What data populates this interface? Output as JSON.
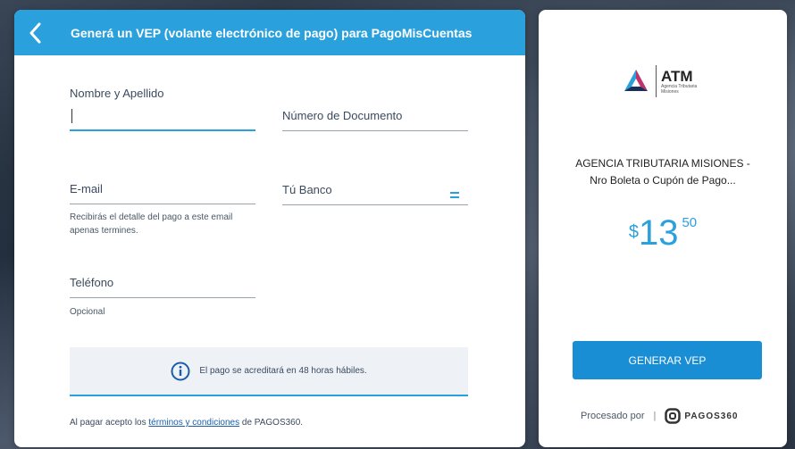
{
  "header": {
    "title": "Generá un VEP (volante electrónico de pago) para PagoMisCuentas"
  },
  "form": {
    "name_label": "Nombre y Apellido",
    "document_label": "Número de Documento",
    "email_label": "E-mail",
    "email_helper": "Recibirás el detalle del pago a este email apenas termines.",
    "bank_label": "Tú Banco",
    "phone_label": "Teléfono",
    "phone_helper": "Opcional"
  },
  "info": {
    "text": "El pago se acreditará en 48 horas hábiles."
  },
  "terms": {
    "prefix": "Al pagar acepto los ",
    "link": "términos y condiciones",
    "suffix": " de PAGOS360."
  },
  "summary": {
    "logo_name": "ATM",
    "logo_sub_1": "Agencia Tributaria",
    "logo_sub_2": "Misiones",
    "description_1": "AGENCIA TRIBUTARIA MISIONES -",
    "description_2": "Nro Boleta o Cupón de Pago...",
    "currency": "$",
    "amount_int": "13",
    "amount_dec": "50",
    "button_label": "GENERAR VEP",
    "processed_by": "Procesado por",
    "separator": "|",
    "brand": "PAGOS360"
  },
  "colors": {
    "accent": "#2aa0dd",
    "button": "#1a8ed4"
  },
  "icons": [
    "chevron-left-icon",
    "menu-lines-icon",
    "info-icon",
    "atm-logo-icon",
    "pagos360-icon"
  ]
}
